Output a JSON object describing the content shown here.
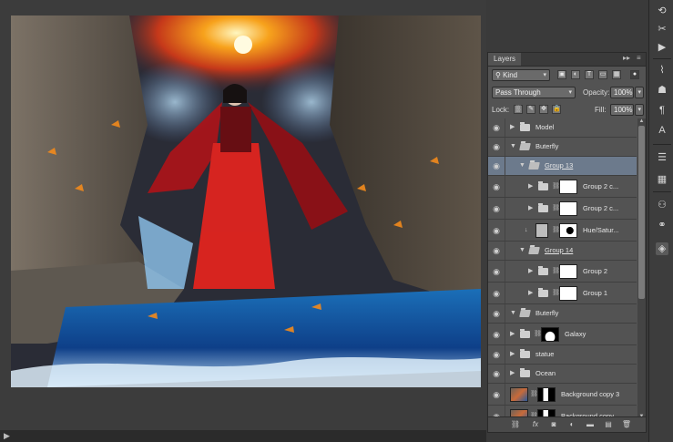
{
  "layers_panel": {
    "tab_label": "Layers",
    "filter_kind": "Kind",
    "blend_mode": "Pass Through",
    "opacity_label": "Opacity:",
    "opacity_value": "100%",
    "lock_label": "Lock:",
    "fill_label": "Fill:",
    "fill_value": "100%",
    "layers": [
      {
        "name": "Model",
        "type": "group",
        "expanded": false,
        "indent": 0,
        "selected": false
      },
      {
        "name": "Buterfly",
        "type": "group",
        "expanded": true,
        "indent": 0,
        "selected": false
      },
      {
        "name": "Group 13",
        "type": "group",
        "expanded": true,
        "indent": 1,
        "selected": true
      },
      {
        "name": "Group 2 c...",
        "type": "group-mask",
        "expanded": false,
        "indent": 2,
        "selected": false
      },
      {
        "name": "Group 2 c...",
        "type": "group-mask",
        "expanded": false,
        "indent": 2,
        "selected": false
      },
      {
        "name": "Hue/Satur...",
        "type": "adjustment",
        "indent": 2,
        "selected": false
      },
      {
        "name": "Group 14",
        "type": "group",
        "expanded": true,
        "indent": 1,
        "selected": false
      },
      {
        "name": "Group 2",
        "type": "group-mask",
        "expanded": false,
        "indent": 2,
        "selected": false
      },
      {
        "name": "Group 1",
        "type": "group-mask",
        "expanded": false,
        "indent": 2,
        "selected": false
      },
      {
        "name": "Buterfly",
        "type": "group",
        "expanded": true,
        "indent": 0,
        "selected": false
      },
      {
        "name": "Galaxy",
        "type": "group-mask",
        "expanded": false,
        "indent": 0,
        "selected": false
      },
      {
        "name": "statue",
        "type": "group",
        "expanded": false,
        "indent": 0,
        "selected": false
      },
      {
        "name": "Ocean",
        "type": "group",
        "expanded": false,
        "indent": 0,
        "selected": false
      },
      {
        "name": "Background copy 3",
        "type": "image-mask",
        "indent": 0,
        "selected": false
      },
      {
        "name": "Background copy",
        "type": "image-mask",
        "indent": 0,
        "selected": false
      }
    ]
  },
  "icons": {
    "footer": [
      "link-icon",
      "fx-icon",
      "add-mask-icon",
      "adjustment-icon",
      "new-group-icon",
      "new-layer-icon",
      "trash-icon"
    ],
    "toolstrip": [
      "history-icon",
      "tool-presets-icon",
      "actions-icon",
      "brush-icon",
      "clone-source-icon",
      "paragraph-icon",
      "character-icon",
      "styles-icon",
      "swatches-icon",
      "paths-icon",
      "channels-icon",
      "layers-icon"
    ]
  },
  "colors": {
    "selected_row": "#6c7a8c",
    "panel_bg": "#535353",
    "app_bg": "#3c3c3c"
  }
}
